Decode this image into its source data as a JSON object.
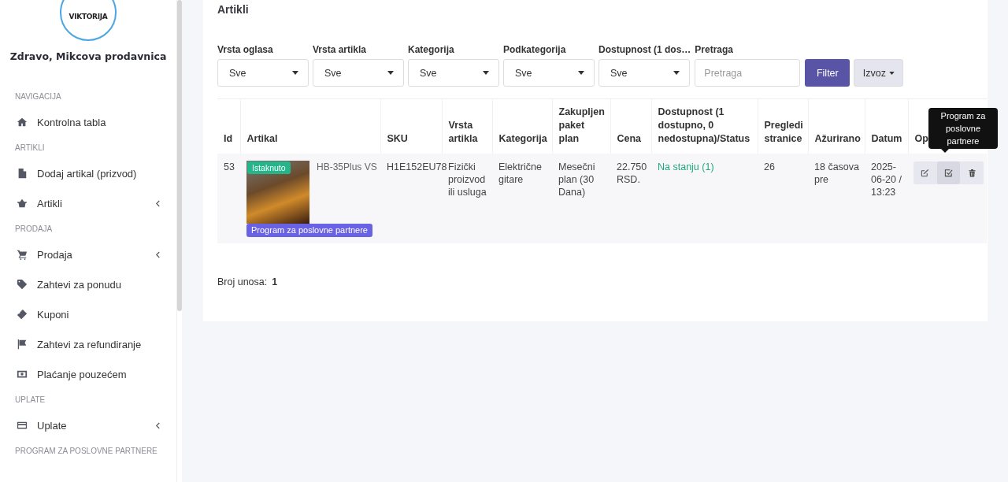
{
  "sidebar": {
    "logo_text": "VIKTORIJA",
    "greeting": "Zdravo, Mikcova prodavnica",
    "sections": [
      {
        "heading": "NAVIGACIJA",
        "items": [
          {
            "label": "Kontrolna tabla",
            "kind": "home",
            "has_submenu": false
          }
        ]
      },
      {
        "heading": "ARTIKLI",
        "items": [
          {
            "label": "Dodaj artikal (prizvod)",
            "kind": "file",
            "has_submenu": false
          },
          {
            "label": "Artikli",
            "kind": "basket",
            "has_submenu": true
          }
        ]
      },
      {
        "heading": "PRODAJA",
        "items": [
          {
            "label": "Prodaja",
            "kind": "cart",
            "has_submenu": true
          },
          {
            "label": "Zahtevi za ponudu",
            "kind": "tag",
            "has_submenu": false
          },
          {
            "label": "Kuponi",
            "kind": "ticket",
            "has_submenu": false
          },
          {
            "label": "Zahtevi za refundiranje",
            "kind": "flag",
            "has_submenu": false
          },
          {
            "label": "Plaćanje pouzećem",
            "kind": "money",
            "has_submenu": false
          }
        ]
      },
      {
        "heading": "UPLATE",
        "items": [
          {
            "label": "Uplate",
            "kind": "card",
            "has_submenu": true
          }
        ]
      },
      {
        "heading": "PROGRAM ZA POSLOVNE PARTNERE"
      }
    ]
  },
  "card": {
    "title": "Artikli",
    "filters": [
      {
        "label": "Vrsta oglasa",
        "value": "Sve"
      },
      {
        "label": "Vrsta artikla",
        "value": "Sve"
      },
      {
        "label": "Kategorija",
        "value": "Sve"
      },
      {
        "label": "Podkategorija",
        "value": "Sve"
      },
      {
        "label": "Dostupnost (1 dos…",
        "value": "Sve"
      }
    ],
    "search": {
      "label": "Pretraga",
      "placeholder": "Pretraga"
    },
    "filter_button": "Filter",
    "export_button": "Izvoz",
    "table": {
      "columns": [
        "Id",
        "Artikal",
        "SKU",
        "Vrsta artikla",
        "Kategorija",
        "Zakupljen paket plan",
        "Cena",
        "Dostupnost (1 dostupno, 0 nedostupna)/Status",
        "Pregledi stranice",
        "Ažurirano",
        "Datum",
        "Op"
      ],
      "rows": [
        {
          "id": "53",
          "featured_badge": "Istaknuto",
          "name": "HB-35Plus VS",
          "partner_badge": "Program za poslovne partnere",
          "sku": "H1E152EU78",
          "type": "Fizički proizvod ili usluga",
          "category": "Električne gitare",
          "plan": "Mesečni plan (30 Dana)",
          "price": "22.750 RSD.",
          "status": "Na stanju (1)",
          "in_stock": true,
          "views": "26",
          "updated": "18 časova pre",
          "date": "2025-06-20 / 13:23",
          "actions": [
            {
              "kind": "edit",
              "highlighted": false
            },
            {
              "kind": "check",
              "highlighted": true
            },
            {
              "kind": "delete",
              "highlighted": false
            }
          ]
        }
      ]
    },
    "tooltip": "Program za poslovne partnere",
    "count_label": "Broj unosa:",
    "count_value": "1"
  }
}
